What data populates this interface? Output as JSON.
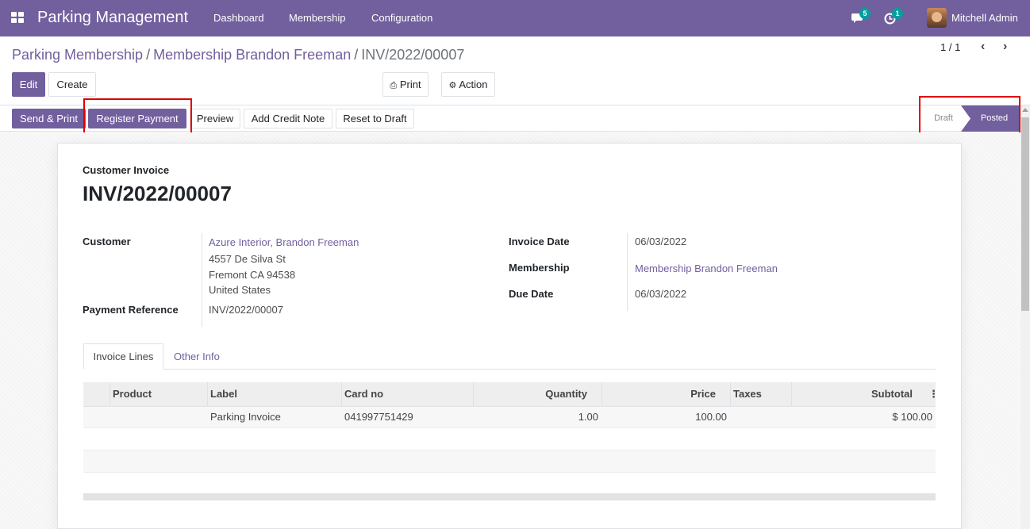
{
  "navbar": {
    "app_title": "Parking Management",
    "menus": [
      "Dashboard",
      "Membership",
      "Configuration"
    ],
    "messages_count": "5",
    "activities_count": "1",
    "user_name": "Mitchell Admin"
  },
  "breadcrumb": {
    "items": [
      "Parking Membership",
      "Membership Brandon Freeman"
    ],
    "active": "INV/2022/00007"
  },
  "toolbar": {
    "edit": "Edit",
    "create": "Create",
    "print": "Print",
    "action": "Action",
    "pager": "1 / 1"
  },
  "statusbar": {
    "buttons": [
      "Send & Print",
      "Register Payment",
      "Preview",
      "Add Credit Note",
      "Reset to Draft"
    ],
    "stages": [
      "Draft",
      "Posted"
    ],
    "current_stage": "Posted"
  },
  "invoice": {
    "type_label": "Customer Invoice",
    "number": "INV/2022/00007",
    "customer_label": "Customer",
    "customer_name": "Azure Interior, Brandon Freeman",
    "address_lines": [
      "4557 De Silva St",
      "Fremont CA 94538",
      "United States"
    ],
    "payment_ref_label": "Payment Reference",
    "payment_ref": "INV/2022/00007",
    "invoice_date_label": "Invoice Date",
    "invoice_date": "06/03/2022",
    "membership_label": "Membership",
    "membership": "Membership Brandon Freeman",
    "due_date_label": "Due Date",
    "due_date": "06/03/2022"
  },
  "tabs": [
    "Invoice Lines",
    "Other Info"
  ],
  "table": {
    "headers": [
      "Product",
      "Label",
      "Card no",
      "Quantity",
      "Price",
      "Taxes",
      "Subtotal"
    ],
    "rows": [
      {
        "product": "",
        "label": "Parking Invoice",
        "card_no": "041997751429",
        "quantity": "1.00",
        "price": "100.00",
        "taxes": "",
        "subtotal": "$ 100.00"
      }
    ]
  },
  "colors": {
    "brand": "#715f9e",
    "badge": "#00a09d",
    "highlight": "#e00000"
  }
}
